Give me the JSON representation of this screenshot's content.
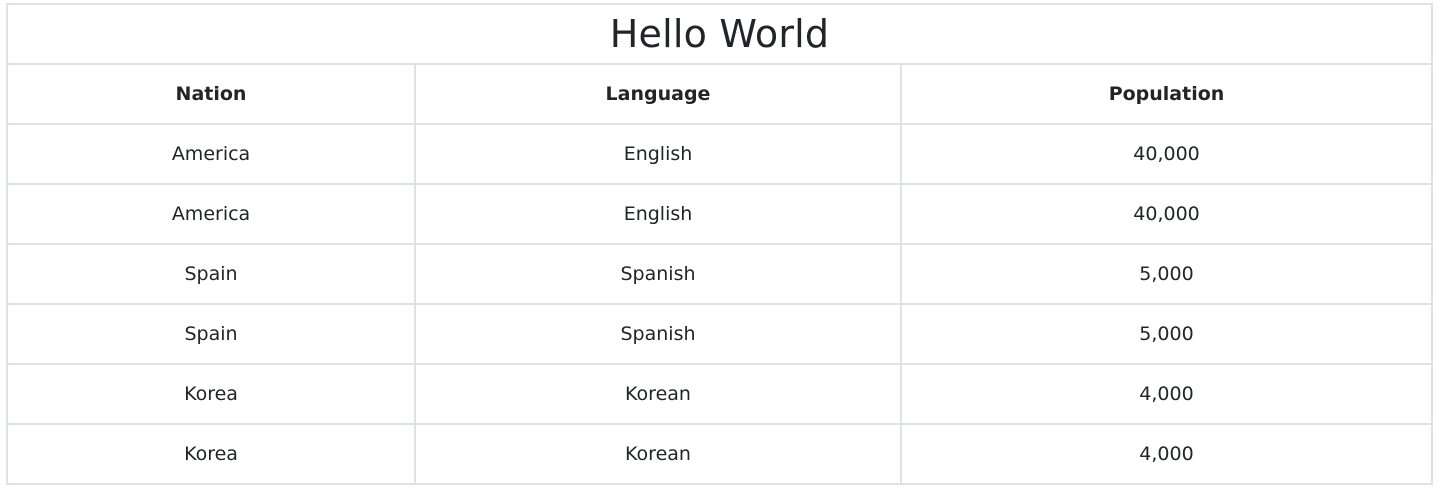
{
  "table": {
    "title": "Hello World",
    "headers": [
      "Nation",
      "Language",
      "Population"
    ],
    "rows": [
      [
        "America",
        "English",
        "40,000"
      ],
      [
        "America",
        "English",
        "40,000"
      ],
      [
        "Spain",
        "Spanish",
        "5,000"
      ],
      [
        "Spain",
        "Spanish",
        "5,000"
      ],
      [
        "Korea",
        "Korean",
        "4,000"
      ],
      [
        "Korea",
        "Korean",
        "4,000"
      ]
    ]
  },
  "colors": {
    "text": "#212529",
    "border": "#dee2e6",
    "background": "#ffffff"
  }
}
